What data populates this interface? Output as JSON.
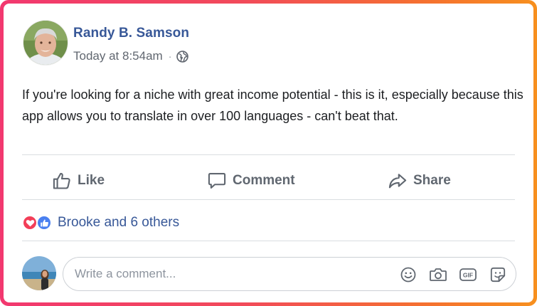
{
  "post": {
    "author": "Randy B. Samson",
    "timestamp": "Today at 8:54am",
    "separator": "·",
    "privacy_icon": "globe-icon",
    "text": "If you're looking for a niche with great income potential - this is it, especially because this app allows you to translate in over 100 languages - can't beat that."
  },
  "actions": {
    "like": "Like",
    "comment": "Comment",
    "share": "Share"
  },
  "reactions": {
    "icons": [
      "love-reaction-icon",
      "like-reaction-icon"
    ],
    "summary": "Brooke and 6 others"
  },
  "comment_box": {
    "placeholder": "Write a comment...",
    "value": "",
    "tools": [
      "emoji-icon",
      "camera-icon",
      "gif-icon",
      "sticker-icon"
    ]
  },
  "colors": {
    "brand_blue": "#385898",
    "text": "#1c1e21",
    "muted": "#606770",
    "love": "#f33e58",
    "like": "#4a80f0",
    "frame_gradient_start": "#f2386f",
    "frame_gradient_end": "#f7901e"
  }
}
